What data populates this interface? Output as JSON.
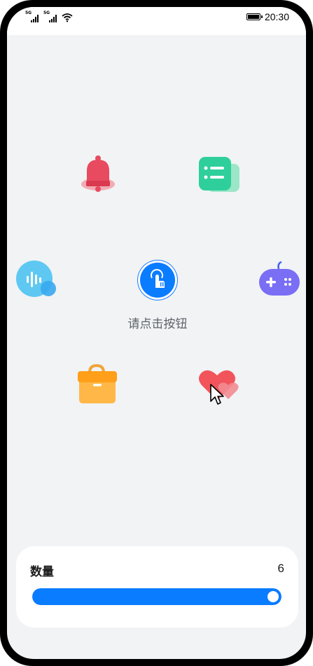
{
  "status_bar": {
    "network_1": "5G",
    "network_2": "5G",
    "time": "20:30"
  },
  "hint_text": "请点击按钮",
  "icons": [
    "bell-icon",
    "list-app-icon",
    "voice-icon",
    "gamepad-icon",
    "toolbox-icon",
    "heart-icon",
    "touch-icon"
  ],
  "quantity": {
    "label": "数量",
    "value": "6",
    "slider_fraction": 1.0
  },
  "colors": {
    "accent": "#0a7cff",
    "bell": "#e84a5f",
    "list_app": "#2ecf9a",
    "voice": "#5ec8f2",
    "gamepad": "#7a6ef5",
    "toolbox": "#ffab2e",
    "heart": "#f2545b"
  }
}
